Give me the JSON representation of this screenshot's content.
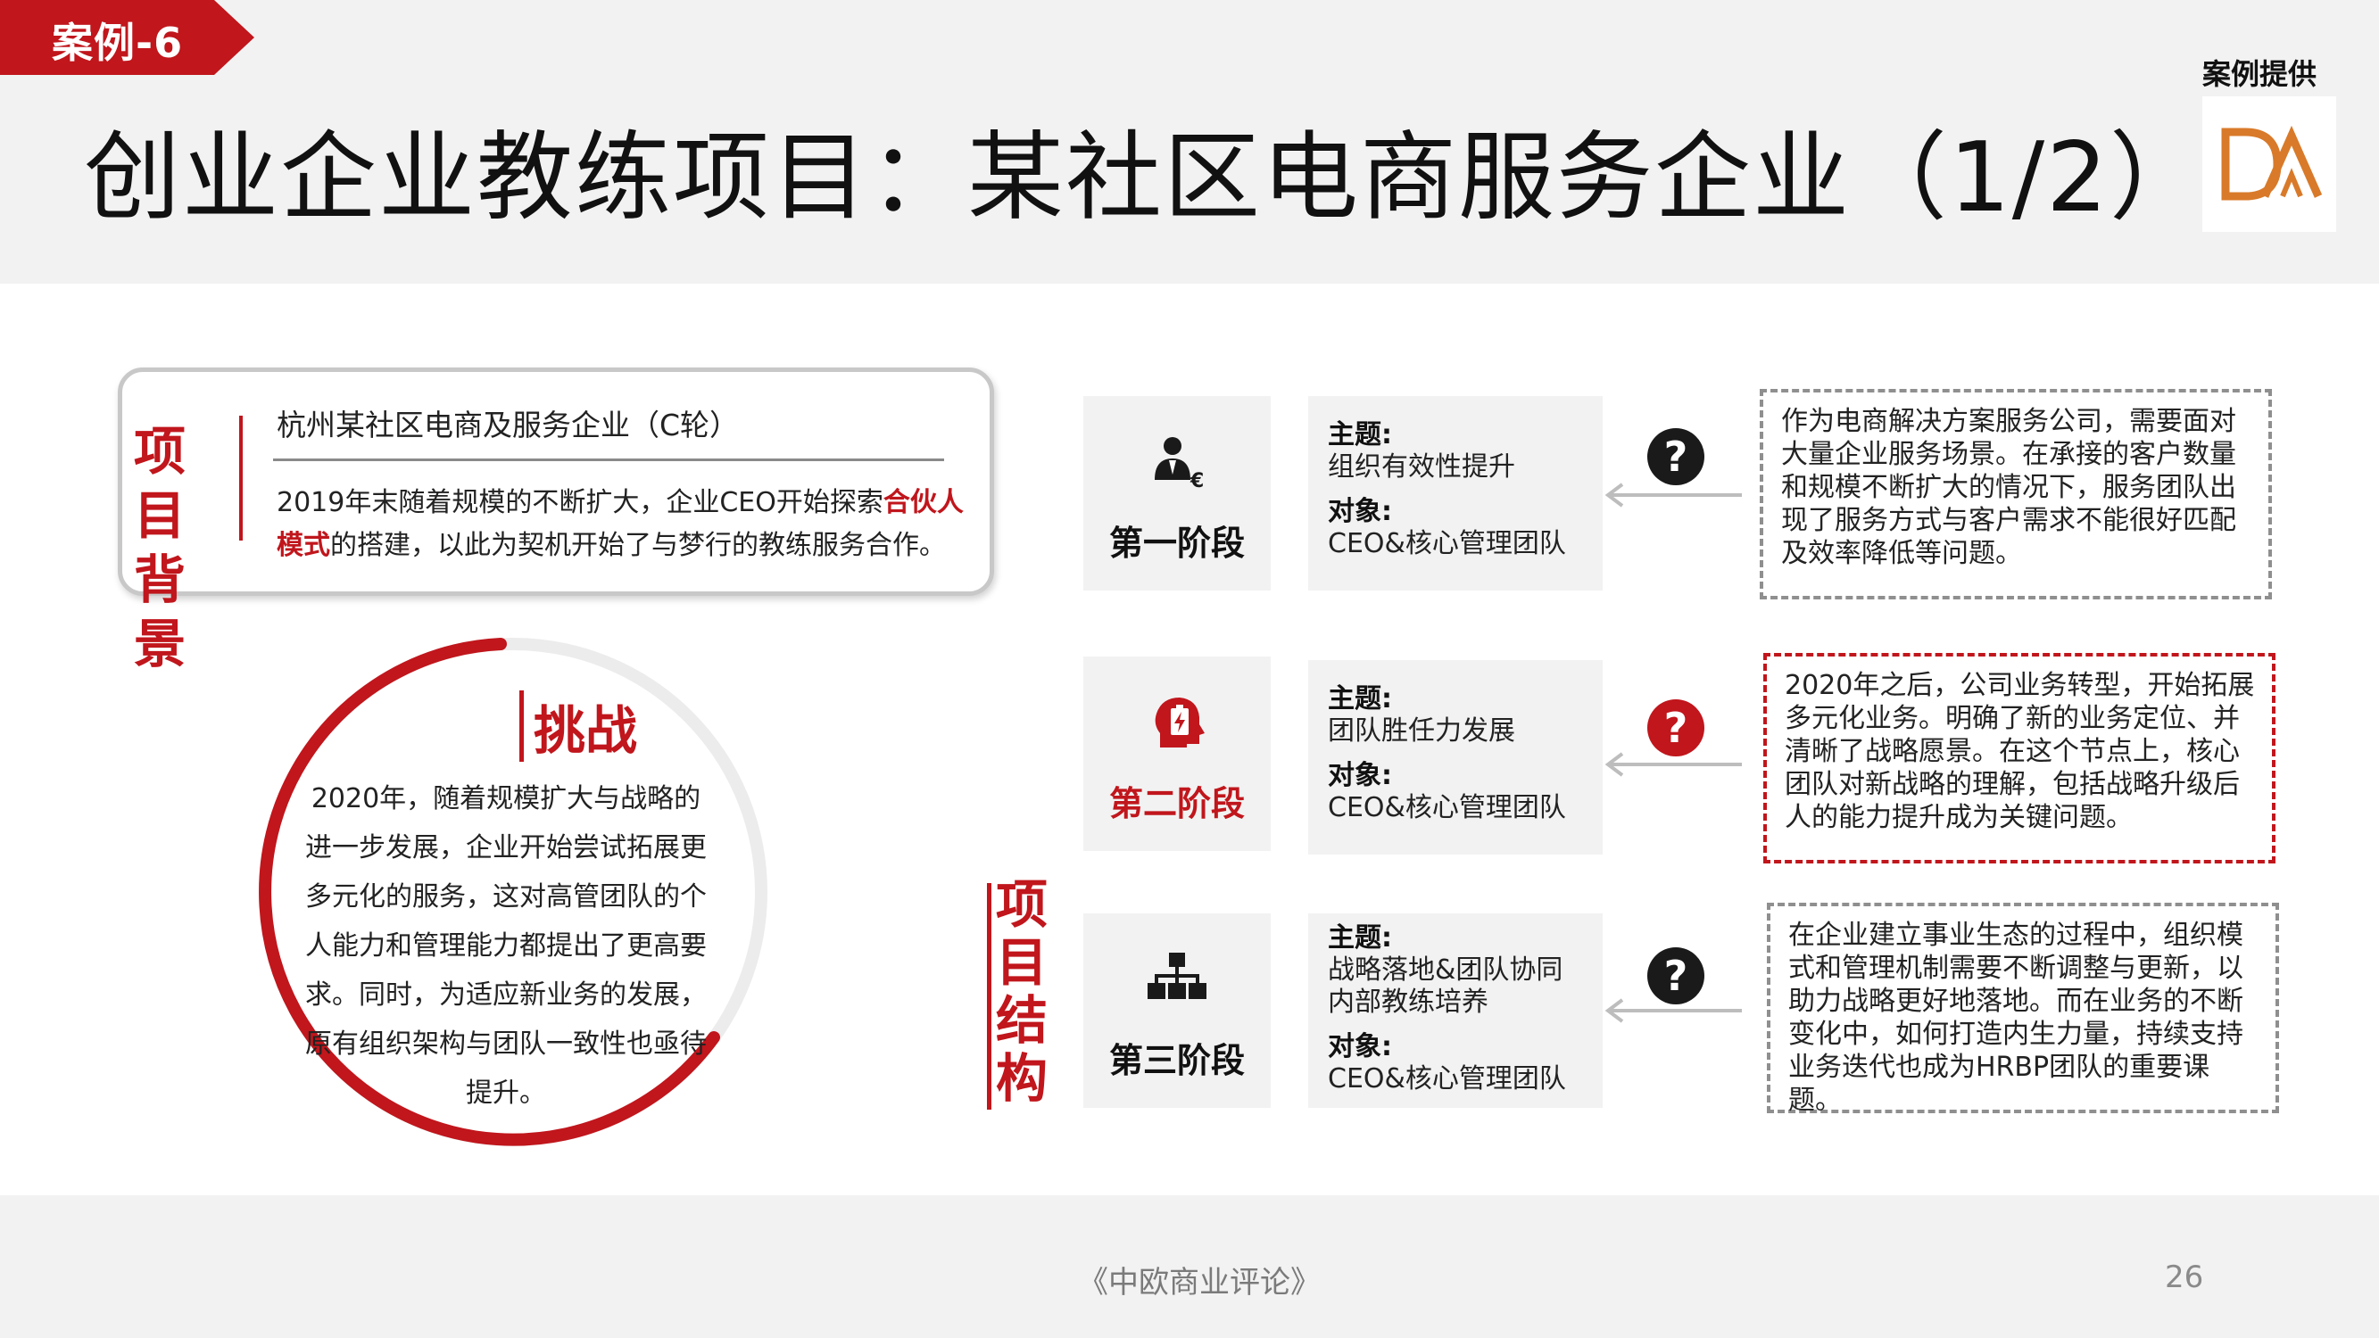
{
  "header": {
    "case_tag": "案例-6",
    "title": "创业企业教练项目：某社区电商服务企业（1/2）",
    "provider_label": "案例提供"
  },
  "colors": {
    "accent": "#c0161c",
    "panel": "#f2f2f2",
    "logo_orange": "#d87a2a",
    "icon_dark": "#1a1a1a"
  },
  "background": {
    "title": "项目背景",
    "company": "杭州某社区电商及服务企业（C轮）",
    "body_before": "2019年末随着规模的不断扩大，企业CEO开始探索",
    "body_highlight": "合伙人模式",
    "body_after": "的搭建，以此为契机开始了与梦行的教练服务合作。"
  },
  "challenge": {
    "title": "挑战",
    "body": "2020年，随着规模扩大与战略的进一步发展，企业开始尝试拓展更多元化的服务，这对高管团队的个人能力和管理能力都提出了更高要求。同时，为适应新业务的发展，原有组织架构与团队一致性也亟待提升。"
  },
  "structure": {
    "title": "项目结构",
    "stages": [
      {
        "label": "第一阶段",
        "icon": "person-euro-icon",
        "theme_key": "主题:",
        "theme": "组织有效性提升",
        "target_key": "对象:",
        "target": "CEO&核心管理团队",
        "question": "?",
        "description": "作为电商解决方案服务公司，需要面对大量企业服务场景。在承接的客户数量和规模不断扩大的情况下，服务团队出现了服务方式与客户需求不能很好匹配及效率降低等问题。"
      },
      {
        "label": "第二阶段",
        "icon": "head-battery-icon",
        "theme_key": "主题:",
        "theme": "团队胜任力发展",
        "target_key": "对象:",
        "target": "CEO&核心管理团队",
        "question": "?",
        "description": "2020年之后，公司业务转型，开始拓展多元化业务。明确了新的业务定位、并清晰了战略愿景。在这个节点上，核心团队对新战略的理解，包括战略升级后人的能力提升成为关键问题。"
      },
      {
        "label": "第三阶段",
        "icon": "org-chart-icon",
        "theme_key": "主题:",
        "theme": "战略落地&团队协同\n内部教练培养",
        "target_key": "对象:",
        "target": "CEO&核心管理团队",
        "question": "?",
        "description": "在企业建立事业生态的过程中，组织模式和管理机制需要不断调整与更新，以助力战略更好地落地。而在业务的不断变化中，如何打造内生力量，持续支持业务迭代也成为HRBP团队的重要课题。"
      }
    ]
  },
  "footer": {
    "source": "《中欧商业评论》",
    "page": "26"
  }
}
